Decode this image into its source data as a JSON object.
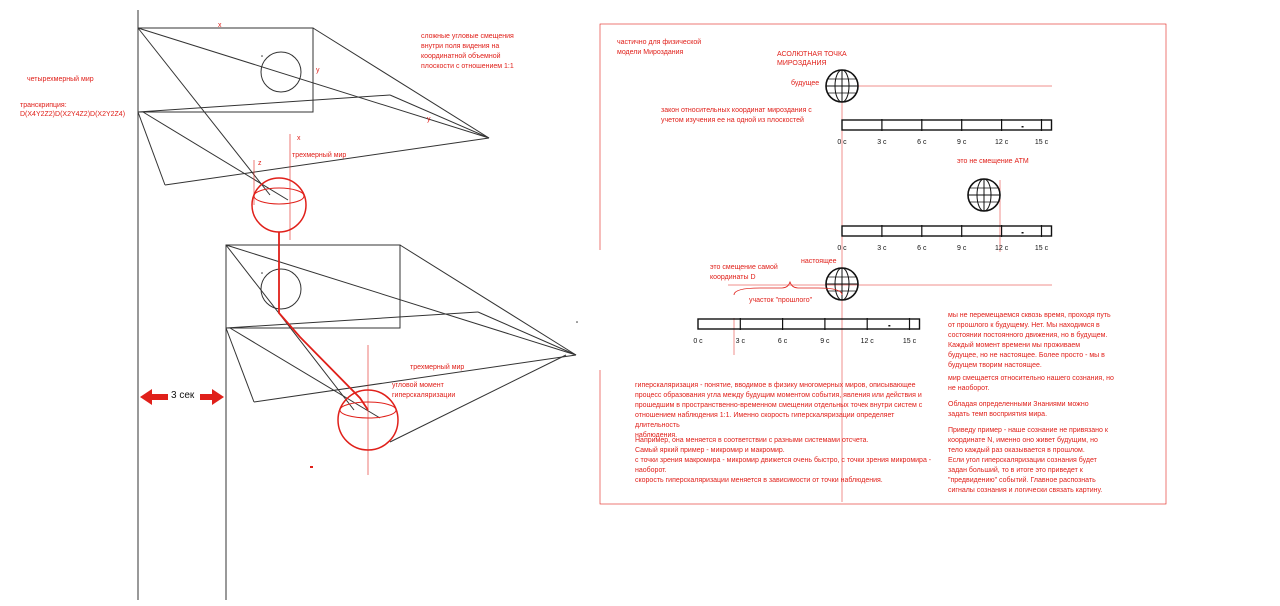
{
  "colors": {
    "accent": "#e0201a",
    "ink": "#333333"
  },
  "left": {
    "label_x_top": "x",
    "label_y_top": "y",
    "label_y_mid": "y",
    "label_x_mid": "x",
    "label_z": "z",
    "four_dim_world": "четырехмерный мир",
    "transcription_label": "транскрипция:",
    "transcription_value": "D(X4Y2Z2)D(X2Y4Z2)D(X2Y2Z4)",
    "angular_note": "сложные угловые смещения\nвнутри поля видения на\nкоординатной объемной\nплоскости с отношением 1:1",
    "three_dim_world_1": "трехмерный мир",
    "three_dim_world_2": "трехмерный мир",
    "angular_moment": "угловой момент\nгиперскаляризации",
    "three_sec": "3 сек"
  },
  "right": {
    "partial_note": "частично для физической\nмодели Мироздания",
    "absolute_point": "АСОЛЮТНАЯ ТОЧКА\nМИРОЗДАНИЯ",
    "future": "будущее",
    "law_note": "закон относительных координат мироздания с\nучетом изучения ее на одной из плоскостей",
    "not_atm": "это не смещение АТМ",
    "present": "настоящее",
    "shift_note": "это смещение самой\nкоординаты  D",
    "past_segment": "участок \"прошлого\"",
    "ticks": [
      "0 с",
      "3 с",
      "6 с",
      "9 с",
      "12 с",
      "15 с"
    ],
    "hyper_para1": "гиперскаляризация - понятие, вводимое в физику многомерных миров, описывающее\nпроцесс образования угла между будущим моментом события, явления или действия и\nпрошедшим в пространственно-временном смещении отдельных точек внутри систем с\nотношением наблюдения 1:1. Именно скорость гиперскаляризации определяет длительность\nнаблюдения.",
    "hyper_para2": "Например, она меняется  в соответствии с разными системами отсчета.\nСамый яркий пример - микромир и макромир.\nс точки зрения макромира - микромир движется очень быстро, с точки зрения микромира -\nнаоборот.\nскорость гиперскаляризации  меняется в зависимости от точки наблюдения.",
    "side_para1": "мы не перемещаемся сквозь время, проходя путь\nот прошлого к будущему.  Нет. Мы находимся в\nсостоянии постоянного движения, но в будущем.\nКаждый момент времени мы проживаем\nбудущее, но не настоящее. Более просто - мы в\nбудущем творим настоящее.",
    "side_para2": "мир смещается относительно нашего сознания, но\nне наоборот.",
    "side_para3": "Обладая определенными Знаниями можно\nзадать темп восприятия мира.",
    "side_para4": "Приведу пример - наше сознание не привязано к\nкоординате N, именно оно живет будущим, но\nтело каждый раз оказывается в прошлом.\nЕсли угол гиперскаляризации сознания будет\nзадан больший, то в итоге это приведет к\n\"предвидению\" событий. Главное распознать\nсигналы сознания  и логически связать картину."
  }
}
